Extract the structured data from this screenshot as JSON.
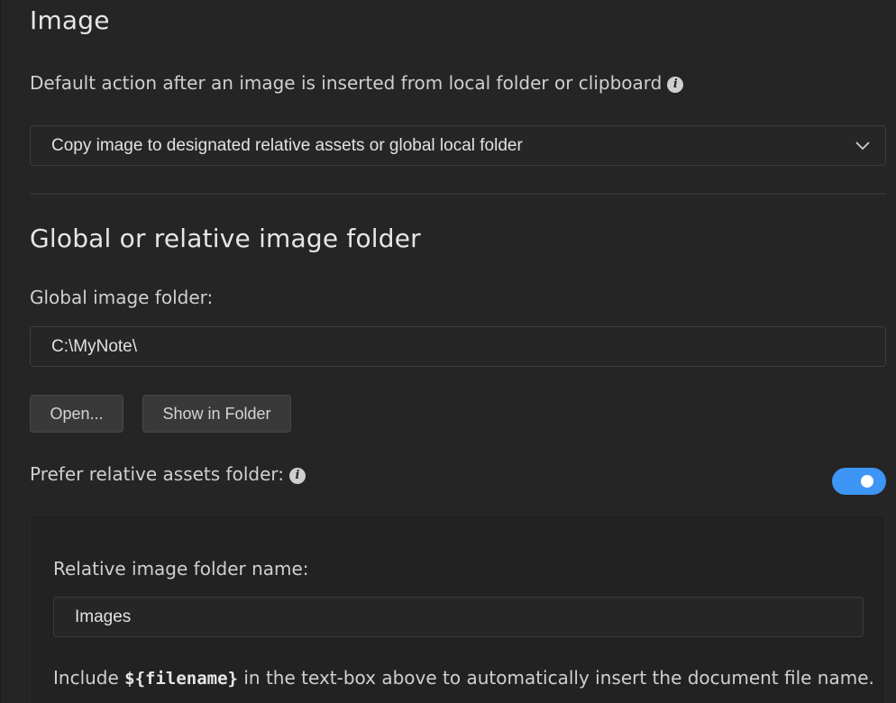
{
  "image_section": {
    "title": "Image",
    "default_action_label": "Default action after an image is inserted from local folder or clipboard",
    "default_action_value": "Copy image to designated relative assets or global local folder",
    "info_icon": "info-icon",
    "dropdown_icon": "chevron-down-icon"
  },
  "folder_section": {
    "title": "Global or relative image folder",
    "global_folder_label": "Global image folder:",
    "global_folder_value": "C:\\MyNote\\",
    "open_button": "Open...",
    "show_in_folder_button": "Show in Folder",
    "prefer_relative_label": "Prefer relative assets folder:",
    "prefer_relative_enabled": true,
    "toggle_color": "#3d95f5"
  },
  "relative_panel": {
    "folder_name_label": "Relative image folder name:",
    "folder_name_value": "Images",
    "note_prefix": "Include ",
    "note_code": "${filename}",
    "note_suffix": " in the text-box above to automatically insert the document file name."
  }
}
